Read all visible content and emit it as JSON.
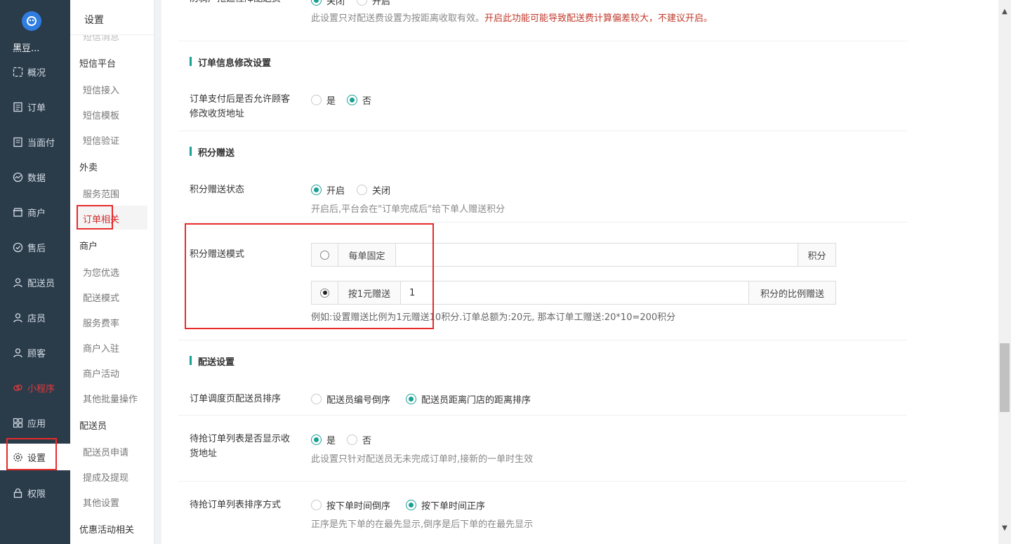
{
  "nav": {
    "brand": "黑豆...",
    "items": [
      {
        "label": "概况",
        "icon": "overview-icon"
      },
      {
        "label": "订单",
        "icon": "order-icon"
      },
      {
        "label": "当面付",
        "icon": "facepay-icon"
      },
      {
        "label": "数据",
        "icon": "data-icon"
      },
      {
        "label": "商户",
        "icon": "shop-icon"
      },
      {
        "label": "售后",
        "icon": "aftersale-icon"
      },
      {
        "label": "配送员",
        "icon": "courier-icon"
      },
      {
        "label": "店员",
        "icon": "clerk-icon"
      },
      {
        "label": "顾客",
        "icon": "customer-icon"
      },
      {
        "label": "小程序",
        "icon": "miniprogram-icon"
      },
      {
        "label": "应用",
        "icon": "apps-icon"
      },
      {
        "label": "设置",
        "icon": "gear-icon"
      },
      {
        "label": "权限",
        "icon": "lock-icon"
      }
    ]
  },
  "subnav": {
    "title": "设置",
    "partial_item": "短信消息",
    "groups": {
      "sms": "短信平台",
      "takeout": "外卖",
      "merchant": "商户",
      "courier": "配送员",
      "promo": "优惠活动相关"
    },
    "items": {
      "sms_access": "短信接入",
      "sms_template": "短信模板",
      "sms_verify": "短信验证",
      "service_area": "服务范围",
      "order_related": "订单相关",
      "preferred": "为您优选",
      "delivery_mode": "配送模式",
      "service_fee": "服务费率",
      "merchant_join": "商户入驻",
      "merchant_activity": "商户活动",
      "batch_ops": "其他批量操作",
      "courier_apply": "配送员申请",
      "commission": "提成及提现",
      "other_settings": "其他设置"
    }
  },
  "main": {
    "top_fragment": {
      "label": "防骑户拖延性降配送费",
      "opt_off": "关闭",
      "opt_on": "开启",
      "hint_normal": "此设置只对配送费设置为按距离收取有效。",
      "hint_warn": "开启此功能可能导致配送费计算偏差较大，不建议开启。"
    },
    "order_edit": {
      "title": "订单信息修改设置",
      "label": "订单支付后是否允许顾客修改收货地址",
      "opt_yes": "是",
      "opt_no": "否",
      "selected": "否"
    },
    "points": {
      "title": "积分赠送",
      "status_label": "积分赠送状态",
      "opt_on": "开启",
      "opt_off": "关闭",
      "status_selected": "开启",
      "status_hint": "开启后,平台会在\"订单完成后\"给下单人赠送积分",
      "mode_label": "积分赠送模式",
      "fixed_label": "每单固定",
      "fixed_value": "",
      "fixed_suffix": "积分",
      "ratio_label": "按1元赠送",
      "ratio_value": "1",
      "ratio_suffix": "积分的比例赠送",
      "mode_selected": "按1元赠送",
      "mode_hint": "例如:设置赠送比例为1元赠送10积分.订单总额为:20元, 那本订单工赠送:20*10=200积分"
    },
    "delivery": {
      "title": "配送设置",
      "sort_label": "订单调度页配送员排序",
      "sort_opt1": "配送员编号倒序",
      "sort_opt2": "配送员距离门店的距离排序",
      "sort_selected": "配送员距离门店的距离排序",
      "show_addr_label": "待抢订单列表是否显示收货地址",
      "show_opt_yes": "是",
      "show_opt_no": "否",
      "show_selected": "是",
      "show_hint": "此设置只针对配送员无未完成订单时,接新的一单时生效",
      "order_sort_label": "待抢订单列表排序方式",
      "order_opt_desc": "按下单时间倒序",
      "order_opt_asc": "按下单时间正序",
      "order_selected": "按下单时间正序",
      "order_hint": "正序是先下单的在最先显示,倒序是后下单的在最先显示"
    }
  },
  "colors": {
    "nav_bg": "#2a3b4a",
    "accent": "#1aa094",
    "highlight_box": "#e82a2a",
    "warn_text": "#c0392b"
  }
}
